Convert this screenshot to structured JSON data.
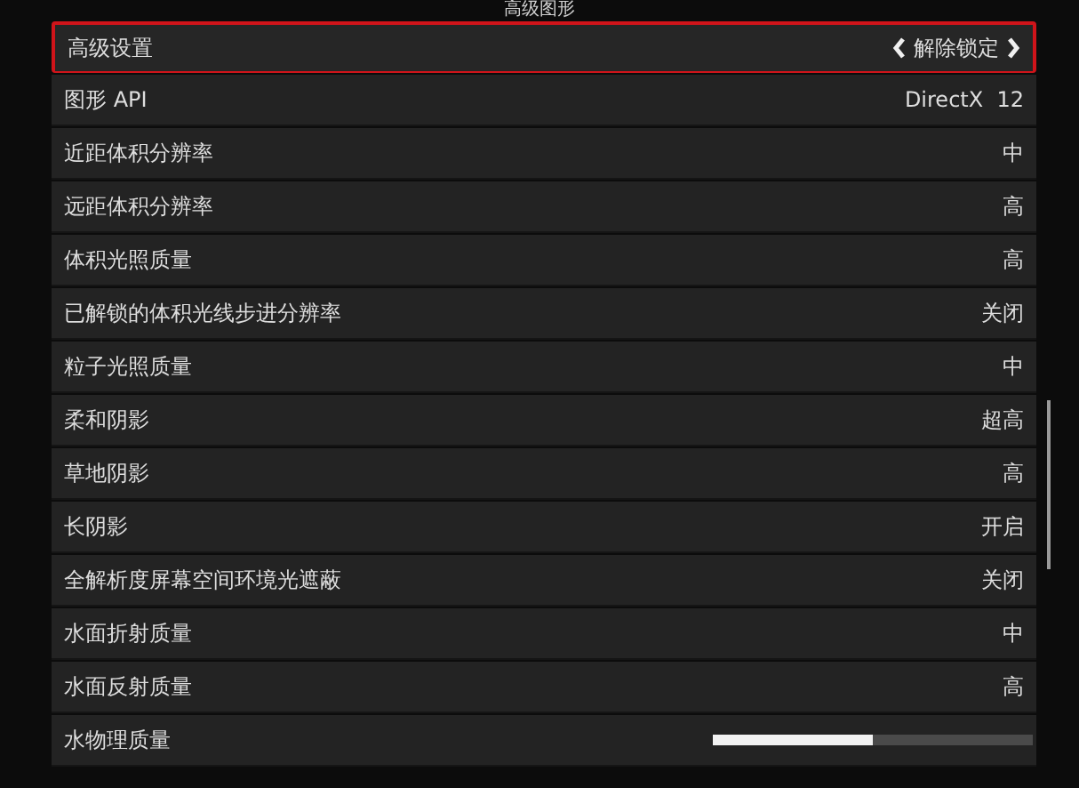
{
  "title": "高级图形",
  "rows": [
    {
      "kind": "selector",
      "label": "高级设置",
      "value": "解除锁定",
      "selected": true
    },
    {
      "kind": "value",
      "label": "图形 API",
      "value": "DirectX  12",
      "selected": false
    },
    {
      "kind": "value",
      "label": "近距体积分辨率",
      "value": "中",
      "selected": false
    },
    {
      "kind": "value",
      "label": "远距体积分辨率",
      "value": "高",
      "selected": false
    },
    {
      "kind": "value",
      "label": "体积光照质量",
      "value": "高",
      "selected": false
    },
    {
      "kind": "value",
      "label": "已解锁的体积光线步进分辨率",
      "value": "关闭",
      "selected": false
    },
    {
      "kind": "value",
      "label": "粒子光照质量",
      "value": "中",
      "selected": false
    },
    {
      "kind": "value",
      "label": "柔和阴影",
      "value": "超高",
      "selected": false
    },
    {
      "kind": "value",
      "label": "草地阴影",
      "value": "高",
      "selected": false
    },
    {
      "kind": "value",
      "label": "长阴影",
      "value": "开启",
      "selected": false
    },
    {
      "kind": "value",
      "label": "全解析度屏幕空间环境光遮蔽",
      "value": "关闭",
      "selected": false
    },
    {
      "kind": "value",
      "label": "水面折射质量",
      "value": "中",
      "selected": false
    },
    {
      "kind": "value",
      "label": "水面反射质量",
      "value": "高",
      "selected": false
    },
    {
      "kind": "slider",
      "label": "水物理质量",
      "level": 0.5,
      "selected": false
    }
  ]
}
